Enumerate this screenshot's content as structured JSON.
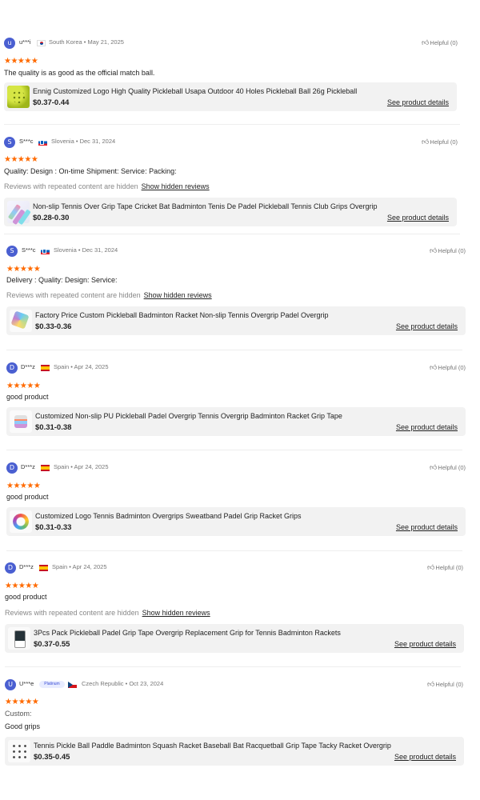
{
  "helpful_label": "Helpful (0)",
  "hidden_note": "Reviews with repeated content are hidden",
  "show_hidden_label": "Show hidden reviews",
  "see_details_label": "See product details",
  "stars": "★★★★★",
  "colors": {
    "star": "#ff6a00",
    "avatar": "#4a5fd1"
  },
  "reviews": [
    {
      "avatar": "u",
      "name": "u***i",
      "flag": "flag-kr-icon",
      "meta": "South Korea • May 21, 2025",
      "lines": [
        "The quality is as good as the official match ball."
      ],
      "product": {
        "name": "Ennig Customized Logo High Quality Pickleball Usapa Outdoor 40 Holes Pickleball Ball 26g Pickleball",
        "price": "$0.37-0.44"
      }
    },
    {
      "avatar": "S",
      "name": "S***c",
      "flag": "flag-si-icon",
      "meta": "Slovenia • Dec 31, 2024",
      "lines": [
        "Quality:  Design :  On-time Shipment:  Service:  Packing:"
      ],
      "product": {
        "name": "Non-slip Tennis Over Grip Tape Cricket Bat Badminton Tenis De Padel Pickleball Tennis Club Grips Overgrip",
        "price": "$0.28-0.30"
      }
    },
    {
      "avatar": "S",
      "name": "S***c",
      "flag": "flag-si-icon",
      "meta": "Slovenia • Dec 31, 2024",
      "lines": [
        "Delivery :  Quality:  Design:  Service:"
      ],
      "product": {
        "name": "Factory Price Custom Pickleball Badminton Racket Non-slip Tennis Overgrip Padel Overgrip",
        "price": "$0.33-0.36"
      }
    },
    {
      "avatar": "D",
      "name": "D***z",
      "flag": "flag-es-icon",
      "meta": "Spain • Apr 24, 2025",
      "lines": [
        "good product"
      ],
      "product": {
        "name": "Customized Non-slip PU Pickleball Padel Overgrip Tennis Overgrip Badminton Racket Grip Tape",
        "price": "$0.31-0.38"
      }
    },
    {
      "avatar": "D",
      "name": "D***z",
      "flag": "flag-es-icon",
      "meta": "Spain • Apr 24, 2025",
      "lines": [
        "good product"
      ],
      "product": {
        "name": "Customized Logo Tennis Badminton Overgrips Sweatband Padel Grip Racket Grips",
        "price": "$0.31-0.33"
      }
    },
    {
      "avatar": "D",
      "name": "D***z",
      "flag": "flag-es-icon",
      "meta": "Spain • Apr 24, 2025",
      "lines": [
        "good product"
      ],
      "product": {
        "name": "3Pcs Pack Pickleball Padel Grip Tape Overgrip Replacement Grip for Tennis Badminton Rackets",
        "price": "$0.37-0.55"
      }
    },
    {
      "avatar": "U",
      "name": "U***e",
      "badge": "Platinum",
      "flag": "flag-cz-icon",
      "meta": "Czech Republic • Oct 23, 2024",
      "lines": [
        "Custom:",
        "Good grips"
      ],
      "product": {
        "name": "Tennis Pickle Ball Paddle Badminton Squash Racket Baseball Bat Racquetball Grip Tape Tacky Racket Overgrip",
        "price": "$0.35-0.45"
      }
    }
  ]
}
